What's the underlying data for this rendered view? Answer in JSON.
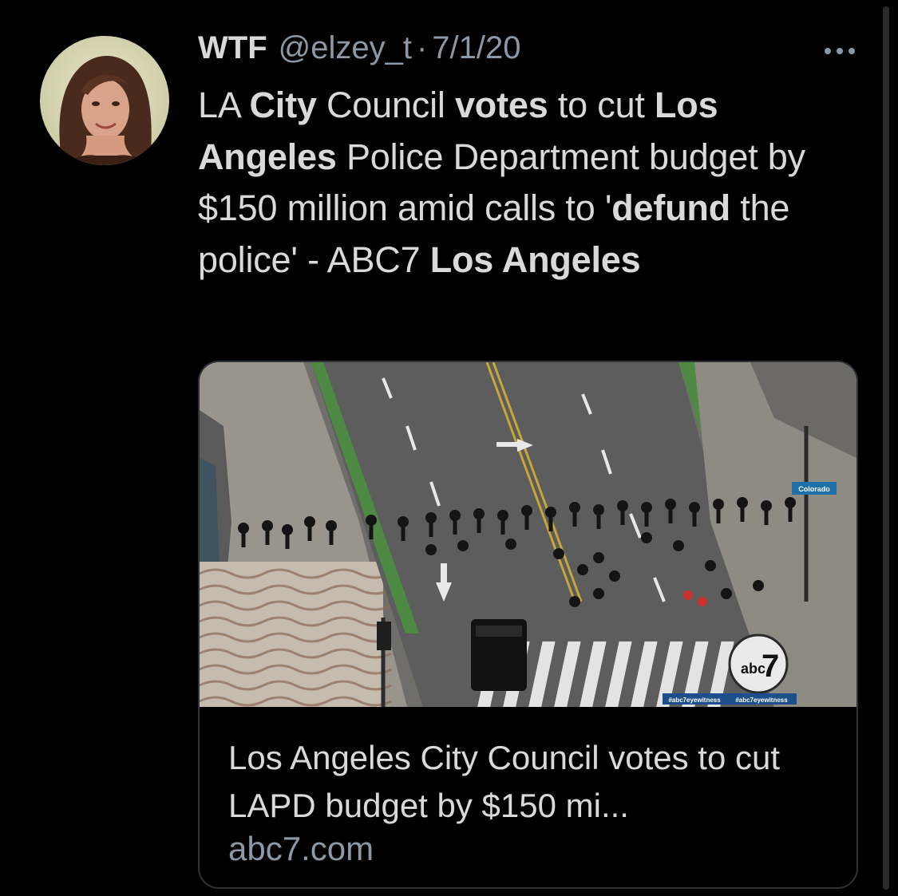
{
  "tweet": {
    "display_name": "WTF",
    "handle": "@elzey_t",
    "separator": "·",
    "date": "7/1/20",
    "more_icon": "ellipsis-icon",
    "text_segments": [
      {
        "t": "LA ",
        "bold": false
      },
      {
        "t": "City",
        "bold": true
      },
      {
        "t": " Council ",
        "bold": false
      },
      {
        "t": "votes",
        "bold": true
      },
      {
        "t": " to cut ",
        "bold": false
      },
      {
        "t": "Los Angeles",
        "bold": true
      },
      {
        "t": " Police Department budget by $150 million amid calls to '",
        "bold": false
      },
      {
        "t": "defund",
        "bold": true
      },
      {
        "t": " the police' - ABC7 ",
        "bold": false
      },
      {
        "t": "Los Angeles",
        "bold": true
      }
    ]
  },
  "card": {
    "image_labels": {
      "street_sign": "Colorado",
      "watermark_1": "#abc7eyewitness",
      "watermark_2": "#abc7eyewitness",
      "logo_text": "abc",
      "logo_number": "7"
    },
    "title": "Los Angeles City Council votes to cut LAPD budget by $150 mi...",
    "domain": "abc7.com"
  },
  "colors": {
    "background": "#000000",
    "primary_text": "#d9d9d9",
    "secondary_text": "#8b98a5",
    "card_border": "#2f3336"
  }
}
